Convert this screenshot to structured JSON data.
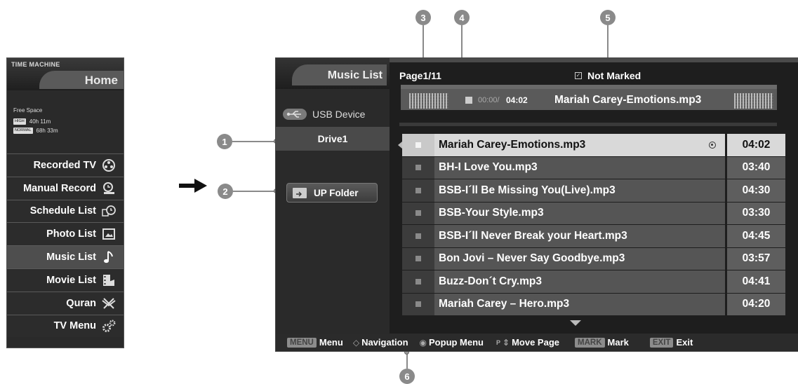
{
  "time_machine": {
    "brand": "TIME MACHINE",
    "home": "Home",
    "free_space": {
      "title": "Free Space",
      "rows": [
        {
          "tag": "HIGH",
          "value": "40h 11m"
        },
        {
          "tag": "NORMAL",
          "value": "68h 33m"
        }
      ]
    },
    "items": [
      {
        "label": "Recorded TV",
        "icon": "reel-icon"
      },
      {
        "label": "Manual Record",
        "icon": "manual-record-icon"
      },
      {
        "label": "Schedule List",
        "icon": "schedule-clock-icon"
      },
      {
        "label": "Photo List",
        "icon": "photo-icon"
      },
      {
        "label": "Music List",
        "icon": "music-note-icon"
      },
      {
        "label": "Movie List",
        "icon": "movie-icon"
      },
      {
        "label": "Quran",
        "icon": "quran-stand-icon"
      },
      {
        "label": "TV Menu",
        "icon": "gears-icon"
      }
    ],
    "active_item": "Music List"
  },
  "callouts": [
    "1",
    "2",
    "3",
    "4",
    "5",
    "6"
  ],
  "music_list": {
    "title": "Music List",
    "device": "USB Device",
    "drive": "Drive1",
    "up_folder": "UP Folder",
    "page": "Page1/11",
    "mark_status": "Not Marked",
    "now_playing": {
      "elapsed": "00:00/",
      "total": "04:02",
      "title": "Mariah Carey-Emotions.mp3"
    },
    "columns": [
      "mark",
      "title",
      "duration"
    ],
    "rows": [
      {
        "title": "Mariah Carey-Emotions.mp3",
        "duration": "04:02"
      },
      {
        "title": "BH-I Love You.mp3",
        "duration": "03:40"
      },
      {
        "title": "BSB-I´ll Be Missing You(Live).mp3",
        "duration": "04:30"
      },
      {
        "title": "BSB-Your Style.mp3",
        "duration": "03:30"
      },
      {
        "title": "BSB-I´ll Never Break your Heart.mp3",
        "duration": "04:45"
      },
      {
        "title": "Bon Jovi – Never Say Goodbye.mp3",
        "duration": "03:57"
      },
      {
        "title": "Buzz-Don´t Cry.mp3",
        "duration": "04:41"
      },
      {
        "title": "Mariah Carey – Hero.mp3",
        "duration": "04:20"
      }
    ],
    "selected_row": 0
  },
  "bottom_bar": {
    "menu_key": "MENU",
    "menu_label": "Menu",
    "nav_label": "Navigation",
    "popup_label": "Popup Menu",
    "page_key": "P",
    "page_label": "Move Page",
    "mark_key": "MARK",
    "mark_label": "Mark",
    "exit_key": "EXIT",
    "exit_label": "Exit"
  },
  "colors": {
    "panel_dark": "#1e1e1e",
    "row_bg": "#555555",
    "row_selected": "#d9d9d9",
    "callout": "#8a8a8a"
  }
}
